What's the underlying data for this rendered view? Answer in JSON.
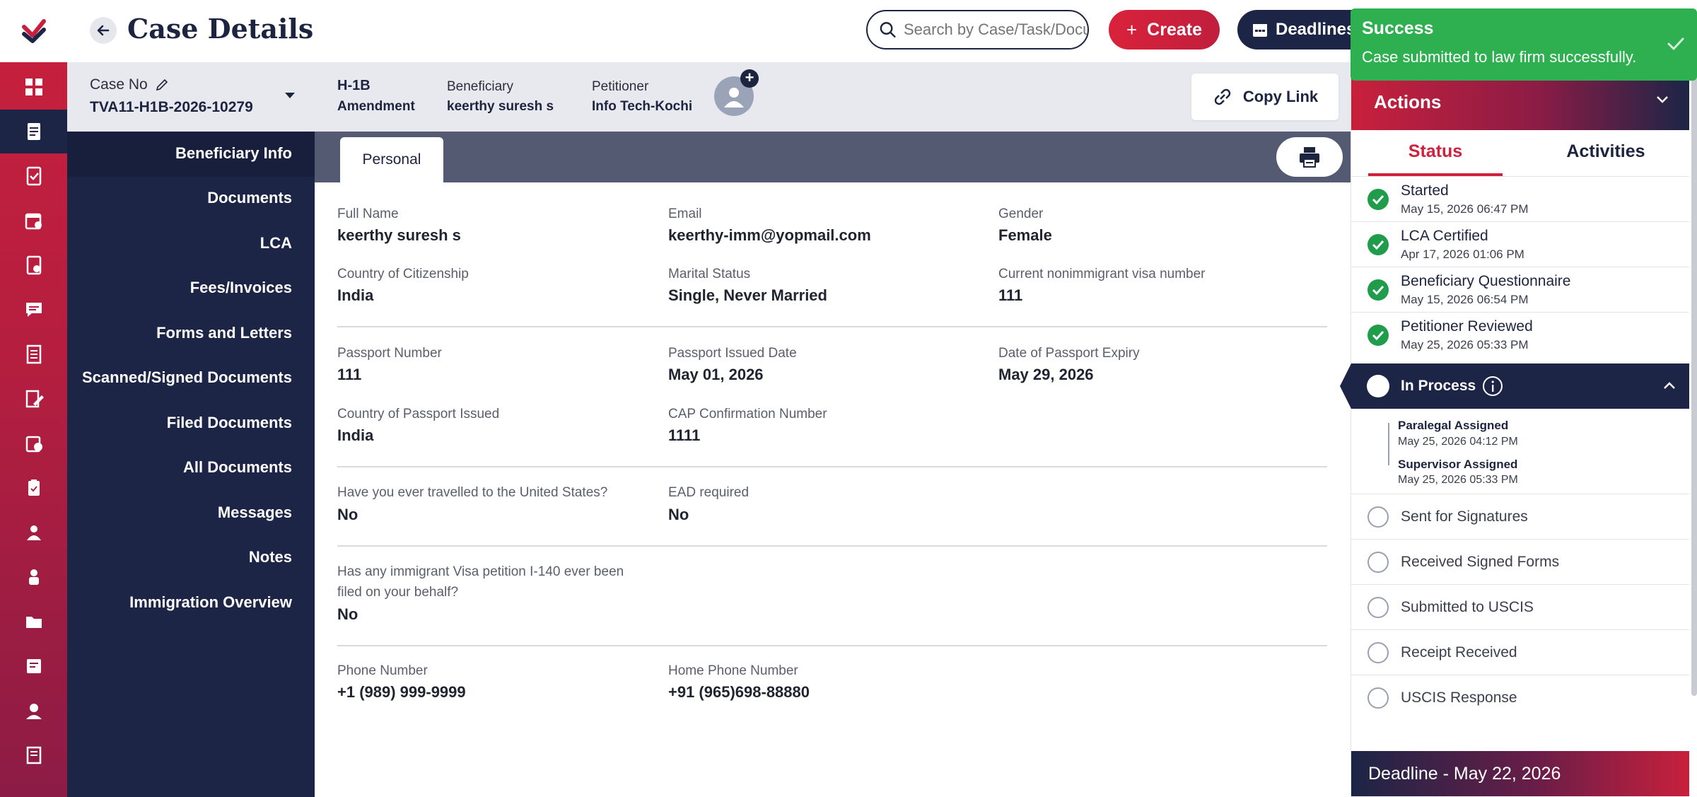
{
  "app": {
    "title": "Case Details",
    "search_placeholder": "Search by Case/Task/Docu",
    "create_label": "Create",
    "deadlines_label": "Deadlines"
  },
  "toast": {
    "title": "Success",
    "message": "Case submitted to law firm successfully."
  },
  "rail_icons": [
    "dashboard-icon",
    "cases-icon",
    "tasks-icon",
    "calendar-icon",
    "checklist-icon",
    "messages-icon",
    "forms-icon",
    "edit-docs-icon",
    "approvals-icon",
    "clipboard-icon",
    "user-icon",
    "team-icon",
    "folder-icon",
    "notes-icon",
    "profile-icon",
    "book-icon"
  ],
  "case": {
    "case_no_label": "Case No",
    "case_no": "TVA11-H1B-2026-10279",
    "visa_type": "H-1B",
    "visa_subtype": "Amendment",
    "beneficiary_label": "Beneficiary",
    "beneficiary": "keerthy suresh s",
    "petitioner_label": "Petitioner",
    "petitioner": "Info Tech-Kochi",
    "copy_link_label": "Copy Link"
  },
  "nav": {
    "items": [
      "Beneficiary Info",
      "Documents",
      "LCA",
      "Fees/Invoices",
      "Forms and Letters",
      "Scanned/Signed Documents",
      "Filed Documents",
      "All Documents",
      "Messages",
      "Notes",
      "Immigration Overview"
    ],
    "active": "Beneficiary Info"
  },
  "tabs": {
    "personal": "Personal"
  },
  "fields": {
    "full_name": {
      "label": "Full Name",
      "value": "keerthy suresh s"
    },
    "email": {
      "label": "Email",
      "value": "keerthy-imm@yopmail.com"
    },
    "gender": {
      "label": "Gender",
      "value": "Female"
    },
    "citizenship": {
      "label": "Country of Citizenship",
      "value": "India"
    },
    "marital": {
      "label": "Marital Status",
      "value": "Single, Never Married"
    },
    "visa_number": {
      "label": "Current nonimmigrant visa number",
      "value": "111"
    },
    "passport_number": {
      "label": "Passport Number",
      "value": "111"
    },
    "passport_issued": {
      "label": "Passport Issued Date",
      "value": "May 01, 2026"
    },
    "passport_expiry": {
      "label": "Date of Passport Expiry",
      "value": "May 29, 2026"
    },
    "passport_country": {
      "label": "Country of Passport Issued",
      "value": "India"
    },
    "cap_number": {
      "label": "CAP Confirmation Number",
      "value": "1111"
    },
    "travelled": {
      "label": "Have you ever travelled to the United States?",
      "value": "No"
    },
    "ead": {
      "label": "EAD required",
      "value": "No"
    },
    "i140_line1": "Has any immigrant Visa petition I-140 ever been",
    "i140_line2": "filed on your behalf?",
    "i140_value": "No",
    "phone": {
      "label": "Phone Number",
      "value": "+1  (989) 999-9999"
    },
    "home_phone": {
      "label": "Home Phone Number",
      "value": "+91  (965)698-88880"
    }
  },
  "actions": {
    "title": "Actions",
    "tab_status": "Status",
    "tab_activities": "Activities",
    "completed": [
      {
        "name": "Started",
        "date": "May 15, 2026 06:47 PM"
      },
      {
        "name": "LCA Certified",
        "date": "Apr 17, 2026 01:06 PM"
      },
      {
        "name": "Beneficiary Questionnaire",
        "date": "May 15, 2026 06:54 PM"
      },
      {
        "name": "Petitioner Reviewed",
        "date": "May 25, 2026 05:33 PM"
      }
    ],
    "in_process": "In Process",
    "sub_steps": [
      {
        "name": "Paralegal Assigned",
        "date": "May 25, 2026 04:12 PM"
      },
      {
        "name": "Supervisor Assigned",
        "date": "May 25, 2026 05:33 PM"
      }
    ],
    "pending": [
      "Sent for Signatures",
      "Received Signed Forms",
      "Submitted to USCIS",
      "Receipt Received",
      "USCIS Response"
    ],
    "deadline": "Deadline - May 22, 2026"
  },
  "colors": {
    "brand_red": "#c8203c",
    "navy": "#1c2546",
    "success_green": "#2eb050"
  }
}
